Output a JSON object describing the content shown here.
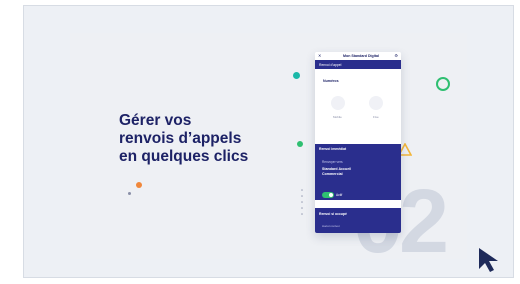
{
  "slide": {
    "headline": [
      "Gérer vos",
      "renvois d’appels",
      "en quelques clics"
    ],
    "big_number": "02"
  },
  "phone": {
    "header_title": "Mon Standard Digital",
    "menu_glyph": "✕",
    "settings_glyph": "⚙",
    "band_label": "Renvoi d’appel",
    "section_title": "Numéros",
    "option_left": "Mobile",
    "option_right": "Fixe",
    "card1": {
      "title": "Renvoi immédiat",
      "subtitle": "Renvoyer vers",
      "target": "Standard Accueil Commercial",
      "toggle_label": "Actif"
    },
    "card2": {
      "title": "Renvoi si occupé",
      "line": "Aucun renvoi"
    }
  },
  "colors": {
    "navy": "#2a2e8d",
    "headline": "#1d2266",
    "teal": "#1bb8a8",
    "green": "#2fbf71",
    "orange": "#f0873a",
    "yellow": "#f3b63a",
    "cursor": "#1e2a5a"
  },
  "icons": [
    "cursor-arrow-icon",
    "settings-icon",
    "close-icon"
  ]
}
